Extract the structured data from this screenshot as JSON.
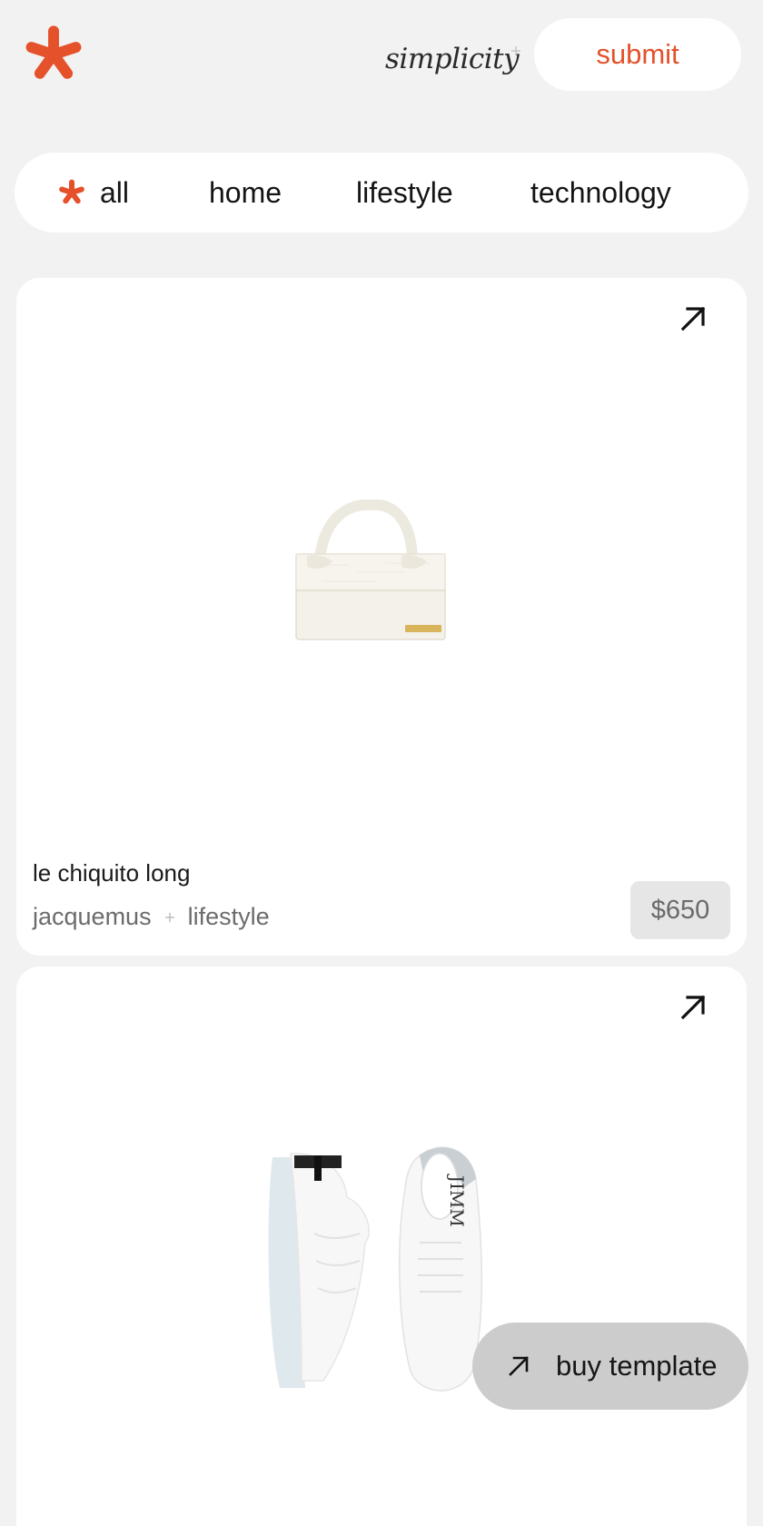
{
  "header": {
    "tagline": "simplicity",
    "submit_label": "submit",
    "accent_color": "#e4512a",
    "logo_icon": "asterisk-logo-icon"
  },
  "nav": {
    "items": [
      {
        "label": "all",
        "icon": "asterisk-icon",
        "active": true
      },
      {
        "label": "home"
      },
      {
        "label": "lifestyle"
      },
      {
        "label": "technology"
      }
    ]
  },
  "products": [
    {
      "title": "le chiquito long",
      "brand": "jacquemus",
      "category": "lifestyle",
      "price": "$650",
      "image_icon": "handbag-image",
      "link_icon": "arrow-up-right-icon"
    },
    {
      "image_icon": "sneakers-image",
      "link_icon": "arrow-up-right-icon"
    }
  ],
  "buy_template": {
    "label": "buy template",
    "icon": "arrow-up-right-icon"
  }
}
